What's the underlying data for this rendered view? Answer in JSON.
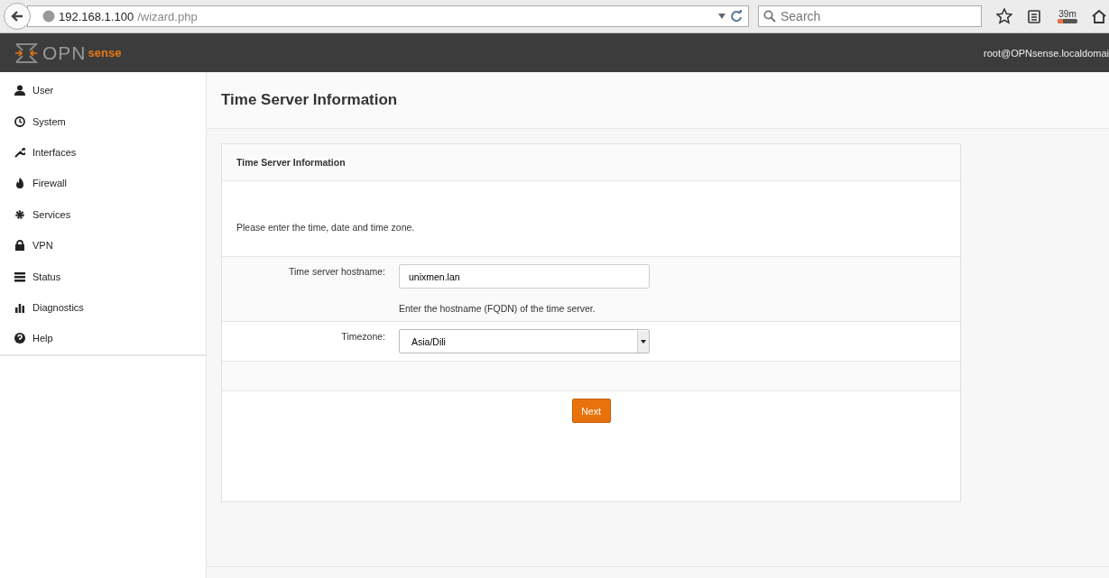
{
  "browser": {
    "url_host": "192.168.1.100",
    "url_path": "/wizard.php",
    "search_placeholder": "Search",
    "download": {
      "label": "39m",
      "level": 0.25
    }
  },
  "header": {
    "logo": {
      "left": "OPN",
      "right": "sense"
    },
    "user": "root@OPNsense.localdomai"
  },
  "sidebar": {
    "items": [
      {
        "label": "User"
      },
      {
        "label": "System"
      },
      {
        "label": "Interfaces"
      },
      {
        "label": "Firewall"
      },
      {
        "label": "Services"
      },
      {
        "label": "VPN"
      },
      {
        "label": "Status"
      },
      {
        "label": "Diagnostics"
      },
      {
        "label": "Help"
      }
    ]
  },
  "page": {
    "title": "Time Server Information"
  },
  "panel": {
    "title": "Time Server Information",
    "description": "Please enter the time, date and time zone.",
    "fields": [
      {
        "kind": "text",
        "label": "Time server hostname:",
        "value": "unixmen.lan",
        "hint": "Enter the hostname (FQDN) of the time server."
      },
      {
        "kind": "select",
        "label": "Timezone:",
        "value": "Asia/Dili"
      }
    ],
    "button": "Next"
  }
}
